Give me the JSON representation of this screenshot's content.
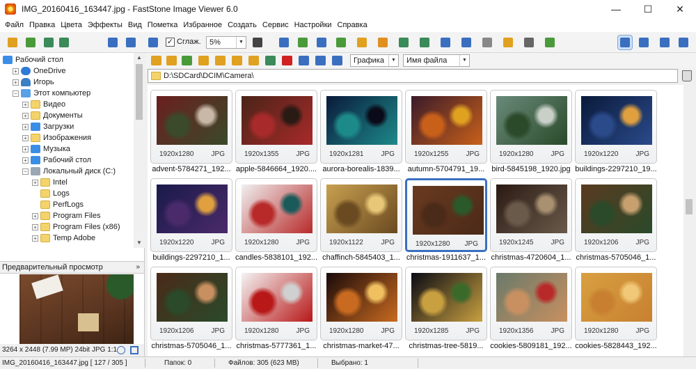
{
  "window": {
    "title": "IMG_20160416_163447.jpg - FastStone Image Viewer 6.0",
    "controls": [
      "—",
      "☐",
      "✕"
    ]
  },
  "menu": [
    "Файл",
    "Правка",
    "Цвета",
    "Эффекты",
    "Вид",
    "Пометка",
    "Избранное",
    "Создать",
    "Сервис",
    "Настройки",
    "Справка"
  ],
  "toolbar": {
    "smooth_label": "Сглаж.",
    "smooth_checked": "✓",
    "zoom_value": "5%"
  },
  "sub_toolbar": {
    "filter_value": "Графика",
    "sort_value": "Имя файла"
  },
  "path": "D:\\SDCard\\DCIM\\Camera\\",
  "tree": [
    {
      "label": "Рабочий стол",
      "icon": "desk",
      "indent": 0,
      "exp": ""
    },
    {
      "label": "OneDrive",
      "icon": "cloud",
      "indent": 1,
      "exp": "+"
    },
    {
      "label": "Игорь",
      "icon": "user",
      "indent": 1,
      "exp": "+"
    },
    {
      "label": "Этот компьютер",
      "icon": "pc",
      "indent": 1,
      "exp": "−"
    },
    {
      "label": "Видео",
      "icon": "folder",
      "indent": 2,
      "exp": "+"
    },
    {
      "label": "Документы",
      "icon": "folder",
      "indent": 2,
      "exp": "+"
    },
    {
      "label": "Загрузки",
      "icon": "desk",
      "indent": 2,
      "exp": "+"
    },
    {
      "label": "Изображения",
      "icon": "folder",
      "indent": 2,
      "exp": "+"
    },
    {
      "label": "Музыка",
      "icon": "desk",
      "indent": 2,
      "exp": "+"
    },
    {
      "label": "Рабочий стол",
      "icon": "desk",
      "indent": 2,
      "exp": "+"
    },
    {
      "label": "Локальный диск (C:)",
      "icon": "drive",
      "indent": 2,
      "exp": "−"
    },
    {
      "label": "Intel",
      "icon": "folder",
      "indent": 3,
      "exp": "+"
    },
    {
      "label": "Logs",
      "icon": "folder",
      "indent": 3,
      "exp": ""
    },
    {
      "label": "PerfLogs",
      "icon": "folder",
      "indent": 3,
      "exp": ""
    },
    {
      "label": "Program Files",
      "icon": "folder",
      "indent": 3,
      "exp": "+"
    },
    {
      "label": "Program Files (x86)",
      "icon": "folder",
      "indent": 3,
      "exp": "+"
    },
    {
      "label": "Temp Adobe",
      "icon": "folder",
      "indent": 3,
      "exp": "+"
    }
  ],
  "preview": {
    "header": "Предварительный просмотр",
    "collapse": "»",
    "info": "3264 x 2448 (7.99 MP)  24bit  JPG  1:1"
  },
  "thumbnails": [
    {
      "name": "advent-5784271_192...",
      "res": "1920x1280",
      "type": "JPG",
      "colors": [
        "#6b1f1f",
        "#3a4a2a",
        "#c9b8a8"
      ]
    },
    {
      "name": "apple-5846664_1920....",
      "res": "1920x1355",
      "type": "JPG",
      "colors": [
        "#4a2418",
        "#a82a2a",
        "#2a1a14"
      ]
    },
    {
      "name": "aurora-borealis-1839...",
      "res": "1920x1281",
      "type": "JPG",
      "colors": [
        "#0a1a3a",
        "#1d8a8a",
        "#0a0a18"
      ]
    },
    {
      "name": "autumn-5704791_19...",
      "res": "1920x1255",
      "type": "JPG",
      "colors": [
        "#3a1a2a",
        "#c8601a",
        "#e0a020"
      ]
    },
    {
      "name": "bird-5845198_1920.jpg",
      "res": "1920x1280",
      "type": "JPG",
      "colors": [
        "#6a8a7a",
        "#2a4a2a",
        "#c8d0c8"
      ]
    },
    {
      "name": "buildings-2297210_19...",
      "res": "1920x1220",
      "type": "JPG",
      "colors": [
        "#0a1a3a",
        "#2a4a8a",
        "#e0a040"
      ]
    },
    {
      "name": "buildings-2297210_1...",
      "res": "1920x1220",
      "type": "JPG",
      "colors": [
        "#1a1a4a",
        "#4a2a6a",
        "#e0a040"
      ]
    },
    {
      "name": "candles-5838101_192...",
      "res": "1920x1280",
      "type": "JPG",
      "colors": [
        "#f0f0f0",
        "#b82a2a",
        "#1a5a5a"
      ]
    },
    {
      "name": "chaffinch-5845403_1...",
      "res": "1920x1122",
      "type": "JPG",
      "colors": [
        "#c8a050",
        "#6a4a20",
        "#e8c878"
      ]
    },
    {
      "name": "christmas-1911637_1...",
      "res": "1920x1280",
      "type": "JPG",
      "colors": [
        "#6a3a20",
        "#4a2a18",
        "#2a5a2a"
      ]
    },
    {
      "name": "christmas-4720604_1...",
      "res": "1920x1245",
      "type": "JPG",
      "colors": [
        "#2a1a14",
        "#6a5a4a",
        "#a89070"
      ]
    },
    {
      "name": "christmas-5705046_1...",
      "res": "1920x1206",
      "type": "JPG",
      "colors": [
        "#5a3a20",
        "#2a4a2a",
        "#c8a070"
      ]
    },
    {
      "name": "christmas-5705046_1...",
      "res": "1920x1206",
      "type": "JPG",
      "colors": [
        "#4a2a18",
        "#2a4a2a",
        "#c89060"
      ]
    },
    {
      "name": "christmas-5777361_1...",
      "res": "1920x1280",
      "type": "JPG",
      "colors": [
        "#f4f4f4",
        "#b81818",
        "#d0d0d0"
      ]
    },
    {
      "name": "christmas-market-47...",
      "res": "1920x1280",
      "type": "JPG",
      "colors": [
        "#1a0a0a",
        "#c86a20",
        "#f0c060"
      ]
    },
    {
      "name": "christmas-tree-5819...",
      "res": "1920x1285",
      "type": "JPG",
      "colors": [
        "#0a0a14",
        "#c8a040",
        "#3a6a2a"
      ]
    },
    {
      "name": "cookies-5809181_192...",
      "res": "1920x1356",
      "type": "JPG",
      "colors": [
        "#6a7a6a",
        "#c89060",
        "#b82a2a"
      ]
    },
    {
      "name": "cookies-5828443_192...",
      "res": "1920x1280",
      "type": "JPG",
      "colors": [
        "#d8a040",
        "#c88030",
        "#f0c878"
      ]
    }
  ],
  "selected_index": 9,
  "status": {
    "file": "IMG_20160416_163447.jpg [ 127 / 305 ]",
    "folders": "Папок: 0",
    "files": "Файлов: 305 (623 MB)",
    "selected": "Выбрано: 1"
  }
}
